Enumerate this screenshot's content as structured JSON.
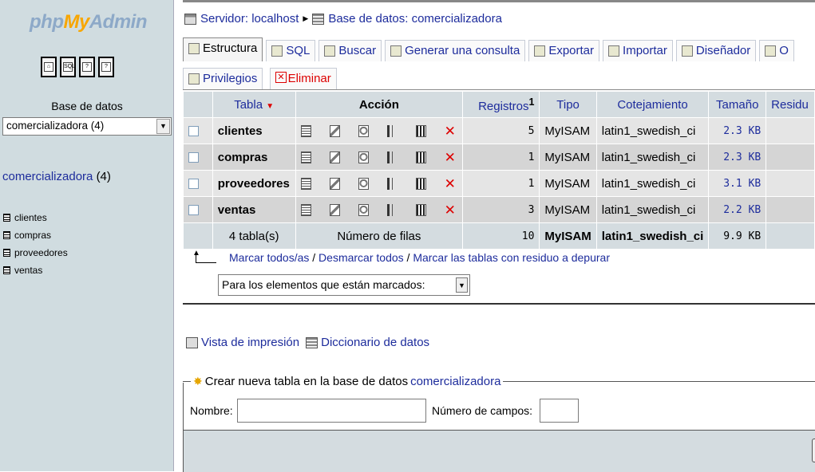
{
  "left": {
    "logo": {
      "php": "php",
      "my": "My",
      "admin": "Admin"
    },
    "quick_icons": [
      "home-icon",
      "sql-query-icon",
      "query-window-icon",
      "docs-icon"
    ],
    "db_label": "Base de datos",
    "db_select": "comercializadora (4)",
    "db_name": "comercializadora",
    "db_count": "(4)",
    "tables": [
      "clientes",
      "compras",
      "proveedores",
      "ventas"
    ]
  },
  "breadcrumb": {
    "server": "Servidor: localhost",
    "database": "Base de datos: comercializadora"
  },
  "tabs": {
    "row1": [
      "Estructura",
      "SQL",
      "Buscar",
      "Generar una consulta",
      "Exportar",
      "Importar",
      "Diseñador",
      "O"
    ],
    "row2": [
      "Privilegios",
      "Eliminar"
    ],
    "active": "Estructura"
  },
  "grid": {
    "headers": {
      "tabla": "Tabla",
      "accion": "Acción",
      "registros": "Registros",
      "registros_sup": "1",
      "tipo": "Tipo",
      "cotejamiento": "Cotejamiento",
      "tamano": "Tamaño",
      "residuo": "Residu"
    },
    "rows": [
      {
        "name": "clientes",
        "records": "5",
        "type": "MyISAM",
        "collation": "latin1_swedish_ci",
        "size": "2.3 KB"
      },
      {
        "name": "compras",
        "records": "1",
        "type": "MyISAM",
        "collation": "latin1_swedish_ci",
        "size": "2.3 KB"
      },
      {
        "name": "proveedores",
        "records": "1",
        "type": "MyISAM",
        "collation": "latin1_swedish_ci",
        "size": "3.1 KB"
      },
      {
        "name": "ventas",
        "records": "3",
        "type": "MyISAM",
        "collation": "latin1_swedish_ci",
        "size": "2.2 KB"
      }
    ],
    "footer": {
      "count": "4 tabla(s)",
      "label": "Número de filas",
      "records": "10",
      "type": "MyISAM",
      "collation": "latin1_swedish_ci",
      "size": "9.9 KB"
    }
  },
  "mark": {
    "check_all": "Marcar todos/as",
    "uncheck_all": "Desmarcar todos",
    "overhead": "Marcar las tablas con residuo a depurar",
    "sep": " / ",
    "with_selected": "Para los elementos que están marcados:"
  },
  "links": {
    "print_view": "Vista de impresión",
    "data_dictionary": "Diccionario de datos"
  },
  "create": {
    "legend": "Crear nueva tabla en la base de datos",
    "legend_db": "comercializadora",
    "name_label": "Nombre:",
    "fields_label": "Número de campos:",
    "name_value": "",
    "fields_value": ""
  },
  "colors": {
    "link": "#1d2c9c",
    "left_bg": "#d0dce0",
    "header_bg": "#d4dce0",
    "drop": "#dd0000"
  }
}
